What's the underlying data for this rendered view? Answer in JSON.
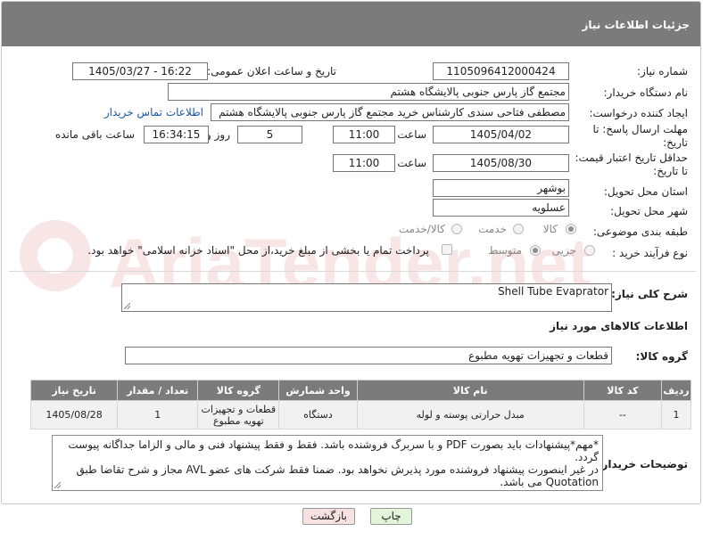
{
  "header": {
    "title": "جزئیات اطلاعات نیاز"
  },
  "need_number": {
    "label": "شماره نیاز:",
    "value": "1105096412000424"
  },
  "announce_date": {
    "label": "تاریخ و ساعت اعلان عمومی:",
    "value": "1405/03/27 - 16:22"
  },
  "buyer_org": {
    "label": "نام دستگاه خریدار:",
    "value": "مجتمع گاز پارس جنوبی  پالایشگاه هشتم"
  },
  "requester": {
    "label": "ایجاد کننده درخواست:",
    "value": "مصطفی فتاحی سندی کارشناس خرید مجتمع گاز پارس جنوبی  پالایشگاه هشتم",
    "contact_link": "اطلاعات تماس خریدار"
  },
  "deadline": {
    "label_line1": "مهلت ارسال پاسخ: تا",
    "label_line2": "تاریخ:",
    "date": "1405/04/02",
    "time_label": "ساعت",
    "time": "11:00",
    "days": "5",
    "days_label": "روز و",
    "remaining": "16:34:15",
    "remaining_label": "ساعت باقی مانده"
  },
  "price_validity": {
    "label_line1": "حداقل تاریخ اعتبار قیمت:",
    "label_line2": "تا تاریخ:",
    "date": "1405/08/30",
    "time_label": "ساعت",
    "time": "11:00"
  },
  "province": {
    "label": "استان محل تحویل:",
    "value": "بوشهر"
  },
  "city": {
    "label": "شهر محل تحویل:",
    "value": "عسلویه"
  },
  "category": {
    "label": "طبقه بندی موضوعی:",
    "options": [
      "کالا",
      "خدمت",
      "کالا/خدمت"
    ],
    "selected": "کالا"
  },
  "process": {
    "label": "نوع فرآیند خرید :",
    "options": [
      "جزیی",
      "متوسط"
    ],
    "selected": "متوسط",
    "treasury_note": "پرداخت تمام یا بخشی از مبلغ خرید،از محل \"اسناد خزانه اسلامی\" خواهد بود."
  },
  "general_desc": {
    "label": "شرح کلی نیاز:",
    "value": "Shell Tube Evaprator"
  },
  "goods_section": {
    "title": "اطلاعات کالاهای مورد نیاز"
  },
  "goods_group": {
    "label": "گروه کالا:",
    "value": "قطعات و تجهیزات تهویه مطبوع"
  },
  "table": {
    "headers": [
      "ردیف",
      "کد کالا",
      "نام کالا",
      "واحد شمارش",
      "گروه کالا",
      "تعداد / مقدار",
      "تاریخ نیاز"
    ],
    "rows": [
      [
        "1",
        "--",
        "مبدل حرارتی پوسته و لوله",
        "دستگاه",
        "قطعات و تجهیزات تهویه مطبوع",
        "1",
        "1405/08/28"
      ]
    ]
  },
  "buyer_notes": {
    "label": "توضیحات خریدار:",
    "lines": [
      "*مهم*پیشنهادات باید بصورت PDF و با سربرگ فروشنده باشد. فقط و فقط پیشنهاد فنی و مالی و الزاما جداگانه پیوست گردد.",
      "در غیر اینصورت پیشنهاد فروشنده مورد پذیرش نخواهد بود. ضمنا فقط شرکت های عضو AVL مجاز و شرح تقاضا طبق",
      "Quotation می باشد."
    ]
  },
  "buttons": {
    "print": "چاپ",
    "back": "بازگشت"
  },
  "watermark": "AriaTender.net",
  "colors": {
    "header_bg": "#7b7b7b",
    "link": "#1a55a6",
    "print_btn": "#e3f5d8",
    "back_btn": "#f8e1e1"
  }
}
